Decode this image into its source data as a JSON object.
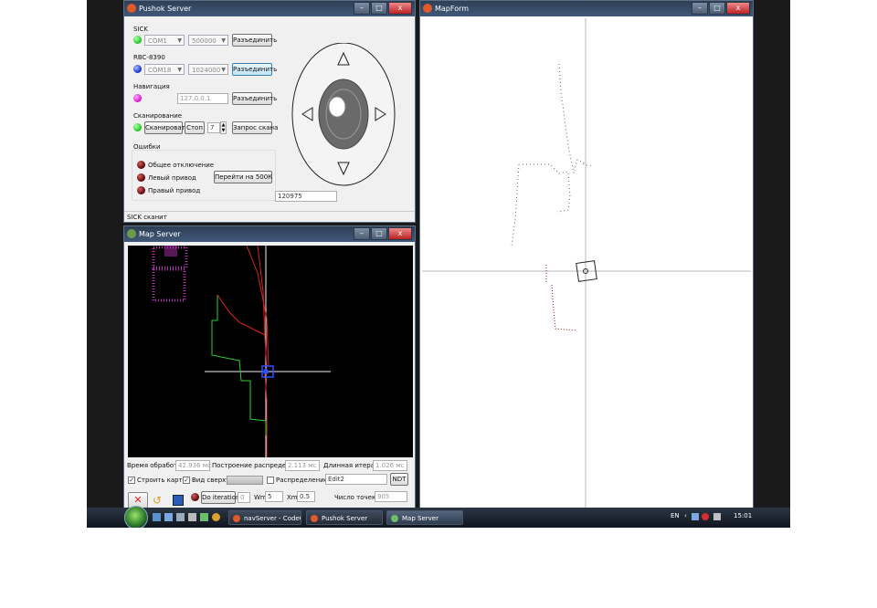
{
  "pushok": {
    "title": "Pushok Server",
    "sick": {
      "label": "SICK",
      "port": "COM1",
      "baud": "500000",
      "button": "Разъединить"
    },
    "rbc": {
      "label": "RBC-8390",
      "port": "COM18",
      "baud": "1024000",
      "button": "Разъединить"
    },
    "nav": {
      "label": "Навигация",
      "ip": "127.0.0.1",
      "button": "Разъединить"
    },
    "scan": {
      "label": "Сканирование",
      "scan_button": "Сканировать",
      "stop_button": "Стоп",
      "count": "7",
      "request_button": "Запрос скана"
    },
    "errors": {
      "label": "Ошибки",
      "items": [
        "Общее отключение",
        "Левый привод",
        "Правый привод"
      ],
      "button": "Перейти на 500К"
    },
    "value_field": "120975",
    "status": "SICK сканит"
  },
  "mapserver": {
    "title": "Map Server",
    "proc_time_label": "Время обработки:",
    "proc_time": "42.936 мс",
    "build_label": "Построение распределения:",
    "build_time": "2.113 мс",
    "iter_label": "Длинная итерация:",
    "iter_time": "1.026 мс",
    "build_map": "Строить карту",
    "top_view": "Вид сверху",
    "distribution": "Распределение",
    "edit_value": "Edit2",
    "ndt_button": "NDT",
    "do_iteration": "Do iteration",
    "iter_count": "0",
    "wm_label": "Wm",
    "wm_value": "5",
    "xm_label": "Xm",
    "xm_value": "0.5",
    "points_label": "Число точек:",
    "points_value": "905"
  },
  "mapform": {
    "title": "MapForm"
  },
  "taskbar": {
    "items": [
      "navServer - CodeGe...",
      "Pushok Server",
      "Map Server"
    ],
    "lang": "EN",
    "clock": "15:01"
  },
  "colors": {
    "sick_led": "#2bd12b",
    "rbc_led": "#1f3ed8",
    "nav_led": "#e020e0",
    "scan_led": "#2bd12b",
    "error_led": "#6a1010"
  }
}
